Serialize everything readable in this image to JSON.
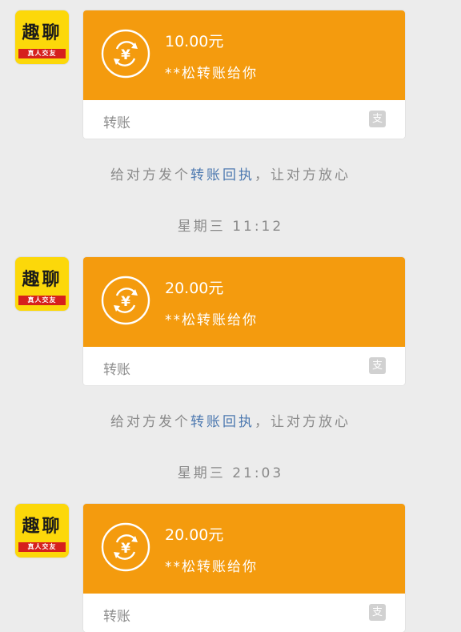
{
  "avatar": {
    "title": "趣聊",
    "subtitle": "真人交友"
  },
  "messages": [
    {
      "amount": "10.00元",
      "sender": "**松转账给你",
      "label": "转账",
      "receipt_prefix": "给对方发个",
      "receipt_link": "转账回执",
      "receipt_suffix": "，让对方放心"
    },
    {
      "amount": "20.00元",
      "sender": "**松转账给你",
      "label": "转账",
      "receipt_prefix": "给对方发个",
      "receipt_link": "转账回执",
      "receipt_suffix": "，让对方放心"
    },
    {
      "amount": "20.00元",
      "sender": "**松转账给你",
      "label": "转账"
    }
  ],
  "timestamps": [
    "星期三 11:12",
    "星期三 21:03"
  ],
  "colors": {
    "card_orange": "#f49b0e",
    "link_blue": "#4d79b0",
    "background": "#ececec"
  },
  "icons": {
    "transfer": "yuan-exchange-icon",
    "payment": "alipay-icon"
  }
}
